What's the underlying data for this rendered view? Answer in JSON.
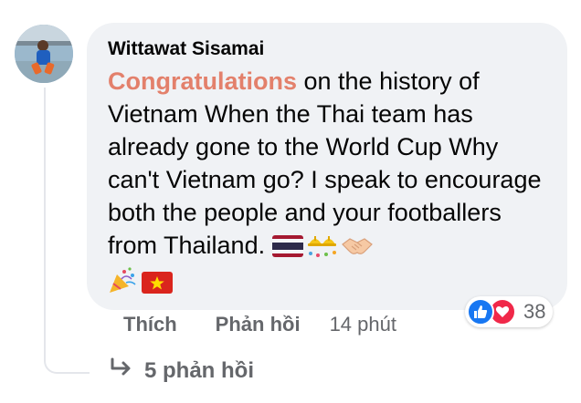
{
  "comment": {
    "author": "Wittawat Sisamai",
    "text_highlight": "Congratulations",
    "text_body": " on the history of Vietnam When the Thai team has already gone to the World Cup Why can't Vietnam go? I speak to encourage both the people and your footballers from Thailand.",
    "emojis": [
      "thailand-flag",
      "hard-hats",
      "handshake",
      "party-popper",
      "vietnam-flag"
    ]
  },
  "reactions": {
    "types": [
      "like",
      "love"
    ],
    "count": "38"
  },
  "actions": {
    "like_label": "Thích",
    "reply_label": "Phản hồi",
    "timestamp": "14 phút"
  },
  "replies": {
    "label": "5 phản hồi"
  },
  "colors": {
    "highlight": "#e3806b",
    "bubble_bg": "#f0f2f5",
    "secondary_text": "#65676b",
    "like_blue": "#1877f2",
    "love_red": "#f02849"
  }
}
